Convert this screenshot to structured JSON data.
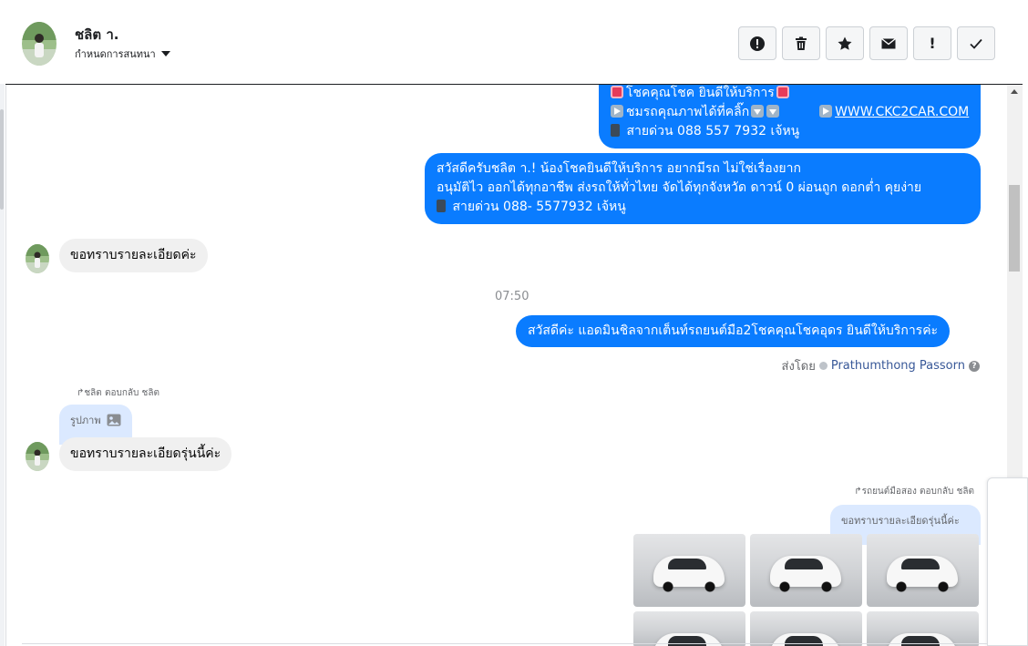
{
  "header": {
    "name": "ชลิต า.",
    "subtitle": "กำหนดการสนทนา"
  },
  "toolbar": {
    "buttons": [
      {
        "name": "report-icon",
        "label": ""
      },
      {
        "name": "trash-icon",
        "label": ""
      },
      {
        "name": "star-icon",
        "label": ""
      },
      {
        "name": "envelope-icon",
        "label": ""
      },
      {
        "name": "important-icon",
        "label": "!"
      },
      {
        "name": "check-icon",
        "label": ""
      }
    ]
  },
  "messages": {
    "m1": {
      "line1": "โชคคุณโชค ยินดีให้บริการ",
      "line2a": "ชมรถคุณภาพได้ที่คลิ๊ก",
      "line2b": "WWW.CKC2CAR.COM",
      "line3": " สายด่วน 088 557 7932 เจ้หนู"
    },
    "m2": {
      "line1": "สวัสดีครับชลิต า.! น้องโชคยินดีให้บริการ อยากมีรถ ไม่ใช่เรื่องยาก",
      "line2": "อนุมัติไว ออกได้ทุกอาชีพ ส่งรถให้ทั่วไทย จัดได้ทุกจังหวัด ดาวน์ 0  ผ่อนถูก ดอกต่ำ คุยง่าย",
      "line3": " สายด่วน 088- 5577932 เจ้หนู"
    },
    "m3": "ขอทราบรายละเอียดค่ะ",
    "time": "07:50",
    "m4": "สวัสดีค่ะ แอดมินชิลจากเต็นท์รถยนต์มือ2โชคคุณโชคอุดร ยินดีให้บริการค่ะ",
    "sent_by_label": "ส่งโดย",
    "sent_by_name": "Prathumthong Passorn",
    "reply1_meta": "ชลิต ตอบกลับ ชลิต",
    "reply1_quote": "รูปภาพ",
    "m5": "ขอทราบรายละเอียดรุ่นนี้ค่ะ",
    "reply2_meta": "รถยนต์มือสอง ตอบกลับ ชลิต",
    "reply2_quote": "ขอทราบรายละเอียดรุ่นนี้ค่ะ"
  },
  "colors": {
    "outgoing": "#0a7cff",
    "incoming": "#f0f0f0",
    "reply_quote": "#dbe9ff"
  }
}
